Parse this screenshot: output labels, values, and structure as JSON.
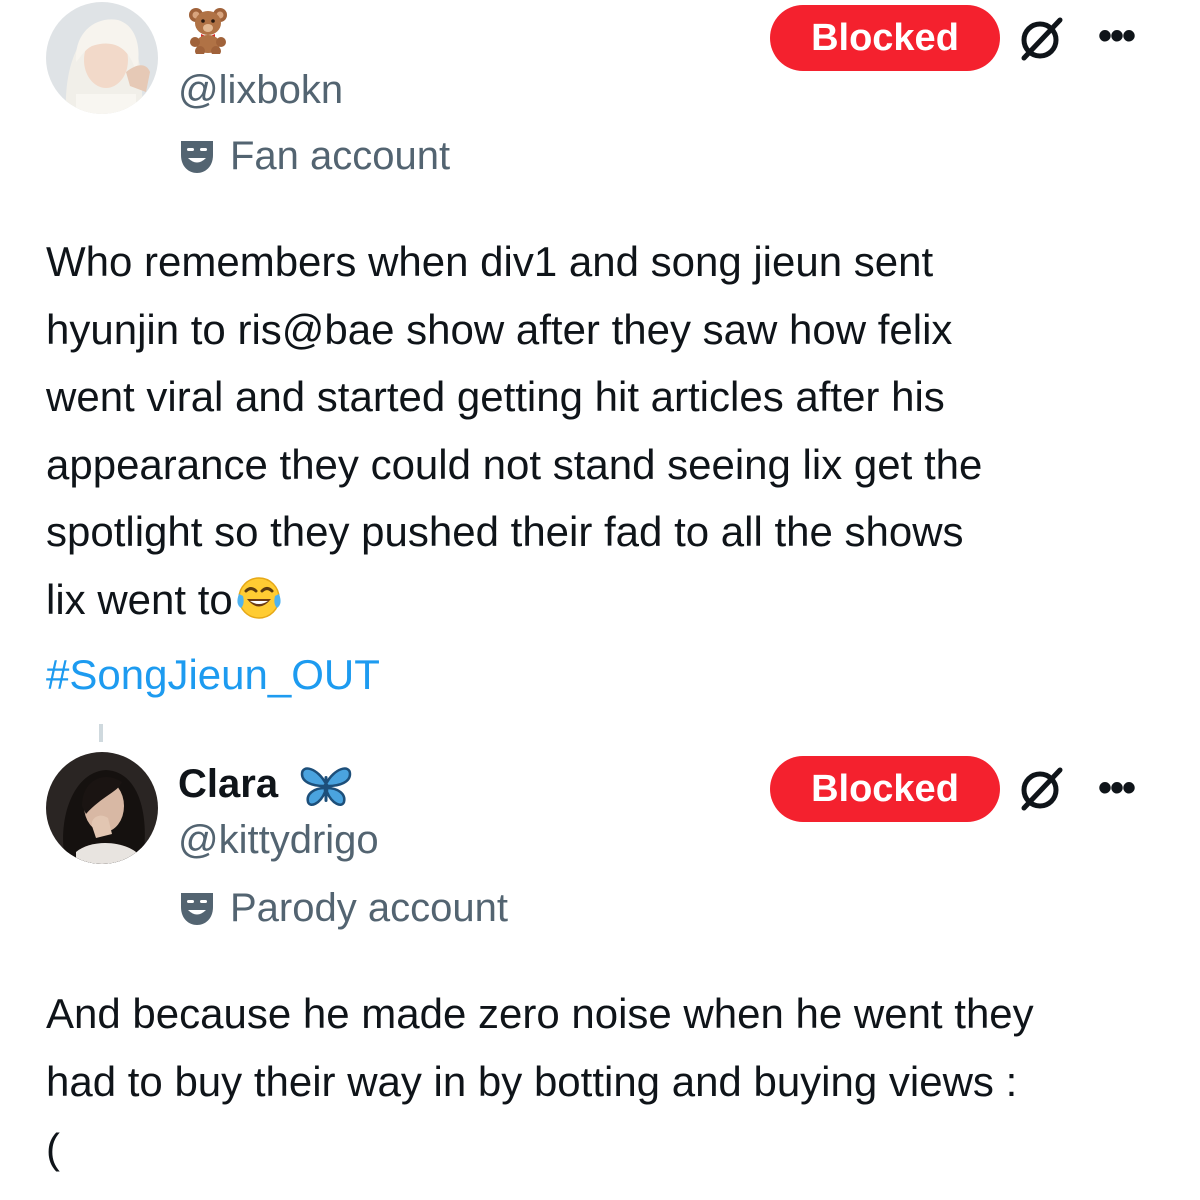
{
  "tweets": [
    {
      "display_name": "",
      "name_emoji_icon": "teddy-bear-emoji",
      "handle": "@lixbokn",
      "account_label": "Fan account",
      "label_icon": "theater-mask-icon",
      "blocked_label": "Blocked",
      "more_label": "•••",
      "text_lines": [
        "Who remembers when div1 and song  jieun sent",
        "hyunjin to  ris@bae show after they saw how felix",
        "went viral and started getting hit articles after his",
        "appearance they could not stand seeing lix get the",
        "spotlight so they pushed their fad to all the shows",
        "lix went to"
      ],
      "trailing_emoji_icon": "face-with-tears-of-joy-emoji",
      "hashtag": "#SongJieun_OUT"
    },
    {
      "display_name": "Clara",
      "name_emoji_icon": "butterfly-emoji",
      "handle": "@kittydrigo",
      "account_label": "Parody account",
      "label_icon": "theater-mask-icon",
      "blocked_label": "Blocked",
      "more_label": "•••",
      "text_lines": [
        "And because he made zero noise when he went they",
        "had to buy their way in by botting and buying views :",
        "("
      ]
    }
  ],
  "colors": {
    "blocked_bg": "#f4212e",
    "hashtag": "#1d9bf0",
    "secondary_text": "#536471",
    "primary_text": "#0f1419"
  }
}
